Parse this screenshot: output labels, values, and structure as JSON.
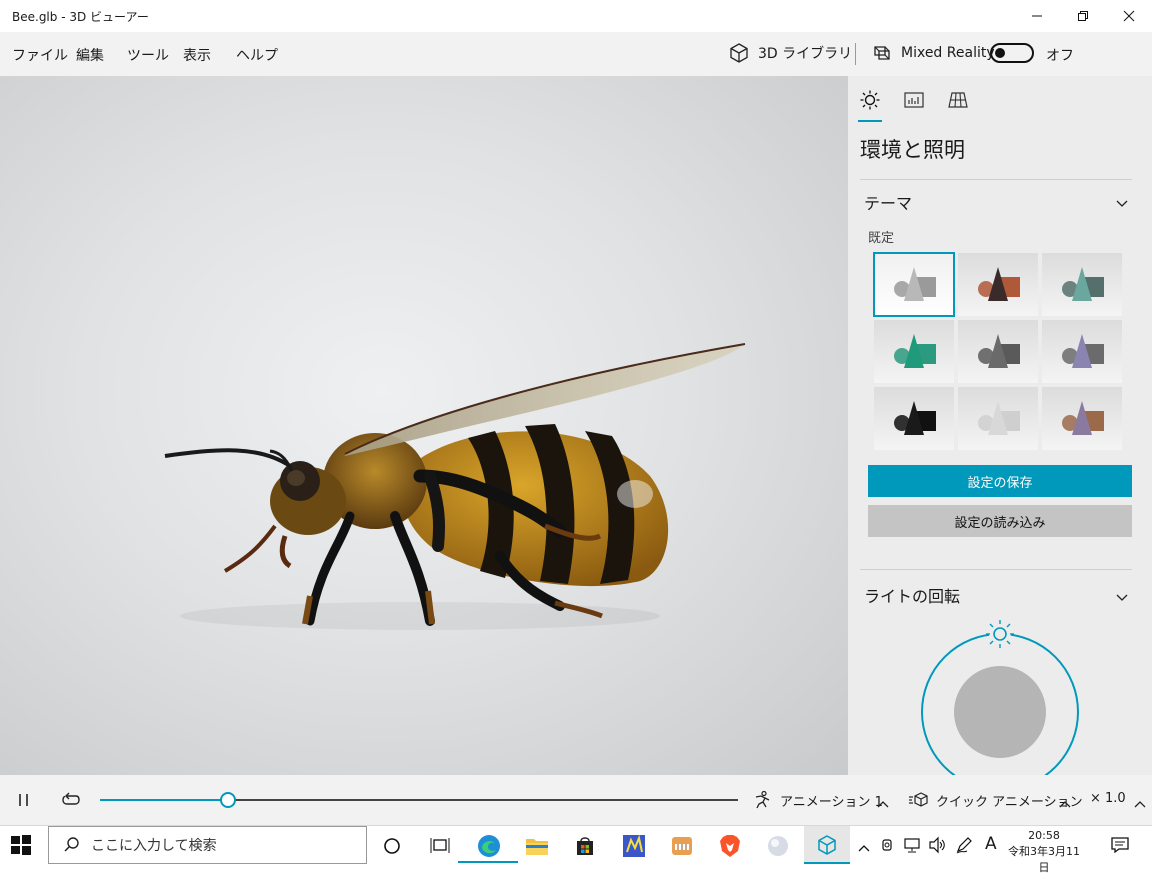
{
  "window": {
    "title": "Bee.glb - 3D ビューアー"
  },
  "menu": {
    "items": [
      "ファイル",
      "編集",
      "ツール",
      "表示",
      "ヘルプ"
    ],
    "library_label": "3D ライブラリ",
    "mixed_reality_label": "Mixed Reality",
    "toggle_state": "オフ"
  },
  "panel": {
    "heading": "環境と照明",
    "theme_section": "テーマ",
    "theme_default_label": "既定",
    "save_button": "設定の保存",
    "load_button": "設定の読み込み",
    "light_rotation_section": "ライトの回転",
    "themes": [
      {
        "name": "theme-1",
        "color": "#b8b8b8",
        "selected": true
      },
      {
        "name": "theme-2",
        "color": "#3a2a2a",
        "accent": "#b0583a"
      },
      {
        "name": "theme-3",
        "color": "#6aa79e",
        "accent": "#55706c"
      },
      {
        "name": "theme-4",
        "color": "#1f9a7a",
        "accent": "#2b9a7e"
      },
      {
        "name": "theme-5",
        "color": "#6a6a6a",
        "accent": "#5a5a5a"
      },
      {
        "name": "theme-6",
        "color": "#8a84b0",
        "accent": "#6b6b6b"
      },
      {
        "name": "theme-7",
        "color": "#1a1a1a",
        "accent": "#111111"
      },
      {
        "name": "theme-8",
        "color": "#d8d8d8",
        "accent": "#cfcfcf"
      },
      {
        "name": "theme-9",
        "color": "#8a7aa0",
        "accent": "#9a6a4a"
      }
    ]
  },
  "playback": {
    "progress": 0.2,
    "animation_label": "アニメーション 1",
    "quick_animation_label": "クイック アニメーション",
    "speed": "× 1.0"
  },
  "taskbar": {
    "search_placeholder": "ここに入力して検索",
    "time": "20:58",
    "date": "令和3年3月11日",
    "ime_indicator": "A"
  },
  "colors": {
    "accent": "#0099bc"
  }
}
